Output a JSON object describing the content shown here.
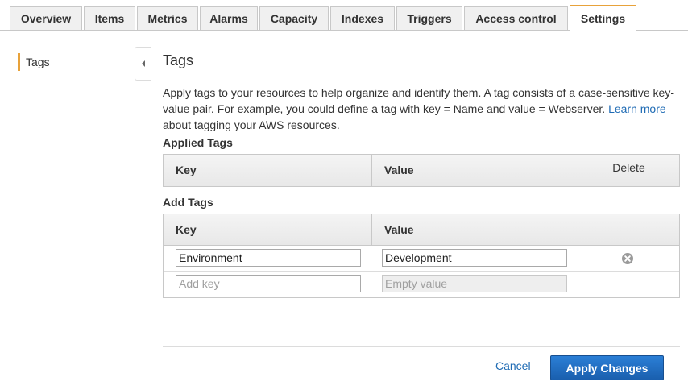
{
  "tabs": [
    {
      "label": "Overview"
    },
    {
      "label": "Items"
    },
    {
      "label": "Metrics"
    },
    {
      "label": "Alarms"
    },
    {
      "label": "Capacity"
    },
    {
      "label": "Indexes"
    },
    {
      "label": "Triggers"
    },
    {
      "label": "Access control"
    },
    {
      "label": "Settings",
      "active": true
    }
  ],
  "sidenav": {
    "items": [
      {
        "label": "Tags",
        "active": true
      }
    ],
    "collapse_icon": "chevron-left-icon"
  },
  "main": {
    "title": "Tags",
    "description": {
      "text": "Apply tags to your resources to help organize and identify them. A tag consists of a case-sensitive key-value pair. For example, you could define a tag with key = Name and value = Webserver. ",
      "link_text": "Learn more",
      "suffix": " about tagging your AWS resources."
    },
    "applied_tags": {
      "label": "Applied Tags",
      "columns": {
        "key": "Key",
        "value": "Value",
        "delete": "Delete"
      }
    },
    "add_tags": {
      "label": "Add Tags",
      "columns": {
        "key": "Key",
        "value": "Value"
      },
      "rows": [
        {
          "key": "Environment",
          "value": "Development",
          "remove_icon": "remove-circle-icon"
        },
        {
          "key_placeholder": "Add key",
          "value_placeholder": "Empty value"
        }
      ]
    },
    "actions": {
      "cancel_label": "Cancel",
      "apply_label": "Apply Changes"
    }
  },
  "colors": {
    "accent": "#e8a23a",
    "link": "#1f6bb4",
    "primary_button": "#1a5fae"
  }
}
